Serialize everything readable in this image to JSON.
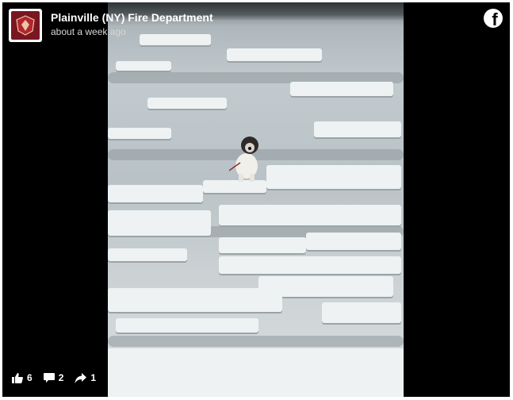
{
  "post": {
    "page_name": "Plainville (NY) Fire Department",
    "timestamp": "about a week ago",
    "avatar": "fire-department-logo",
    "brand_icon": "facebook-icon"
  },
  "stats": {
    "likes": "6",
    "comments": "2",
    "shares": "1"
  },
  "colors": {
    "background": "#000000",
    "text": "#ffffff",
    "ice": "#eef2f3",
    "water": "#8f999d"
  }
}
